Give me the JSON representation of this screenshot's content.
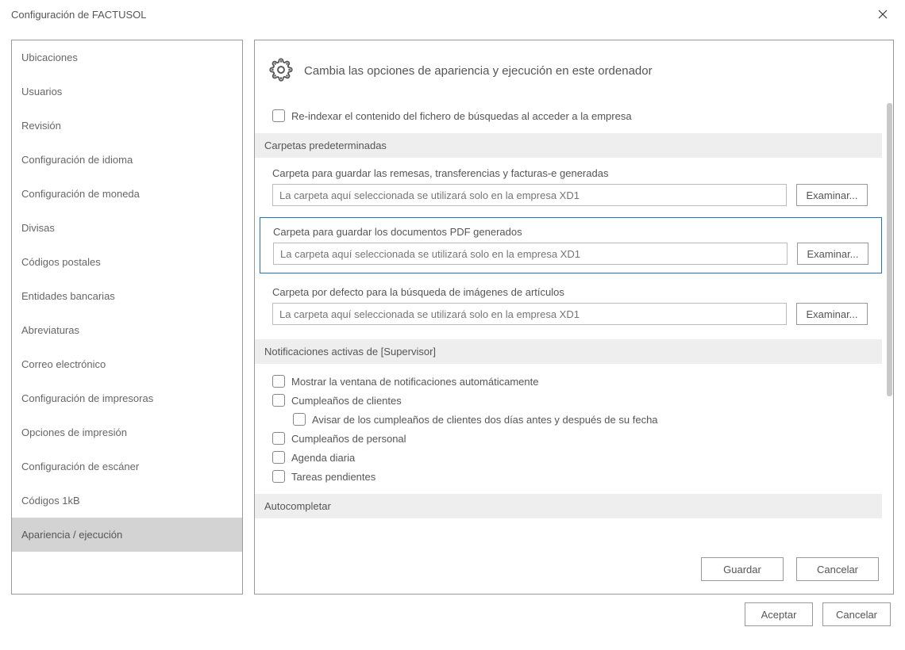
{
  "window": {
    "title": "Configuración de FACTUSOL"
  },
  "sidebar": {
    "items": [
      {
        "label": "Ubicaciones",
        "selected": false
      },
      {
        "label": "Usuarios",
        "selected": false
      },
      {
        "label": "Revisión",
        "selected": false
      },
      {
        "label": "Configuración de idioma",
        "selected": false
      },
      {
        "label": "Configuración de moneda",
        "selected": false
      },
      {
        "label": "Divisas",
        "selected": false
      },
      {
        "label": "Códigos postales",
        "selected": false
      },
      {
        "label": "Entidades bancarias",
        "selected": false
      },
      {
        "label": "Abreviaturas",
        "selected": false
      },
      {
        "label": "Correo electrónico",
        "selected": false
      },
      {
        "label": "Configuración de impresoras",
        "selected": false
      },
      {
        "label": "Opciones de impresión",
        "selected": false
      },
      {
        "label": "Configuración de escáner",
        "selected": false
      },
      {
        "label": "Códigos 1kB",
        "selected": false
      },
      {
        "label": "Apariencia / ejecución",
        "selected": true
      }
    ]
  },
  "content": {
    "header_subtitle": "Cambia las opciones de apariencia y ejecución en este ordenador",
    "reindex_label": "Re-indexar el contenido del fichero de búsquedas al acceder a la empresa",
    "folders_header": "Carpetas predeterminadas",
    "folders": [
      {
        "label": "Carpeta para guardar las remesas, transferencias y facturas-e generadas",
        "placeholder": "La carpeta aquí seleccionada se utilizará solo en la empresa XD1",
        "button": "Examinar...",
        "highlighted": false
      },
      {
        "label": "Carpeta para guardar los documentos PDF generados",
        "placeholder": "La carpeta aquí seleccionada se utilizará solo en la empresa XD1",
        "button": "Examinar...",
        "highlighted": true
      },
      {
        "label": "Carpeta por defecto para la búsqueda de imágenes de artículos",
        "placeholder": "La carpeta aquí seleccionada se utilizará solo en la empresa XD1",
        "button": "Examinar...",
        "highlighted": false
      }
    ],
    "notifications_header": "Notificaciones activas de [Supervisor]",
    "notifications": [
      {
        "label": "Mostrar la ventana de notificaciones automáticamente",
        "indented": false
      },
      {
        "label": "Cumpleaños de clientes",
        "indented": false
      },
      {
        "label": "Avisar de los cumpleaños de clientes dos días antes y después de su fecha",
        "indented": true
      },
      {
        "label": "Cumpleaños de personal",
        "indented": false
      },
      {
        "label": "Agenda diaria",
        "indented": false
      },
      {
        "label": "Tareas pendientes",
        "indented": false
      }
    ],
    "autocomplete_header": "Autocompletar",
    "save_button": "Guardar",
    "cancel_button": "Cancelar"
  },
  "dialog": {
    "accept_button": "Aceptar",
    "cancel_button": "Cancelar"
  }
}
